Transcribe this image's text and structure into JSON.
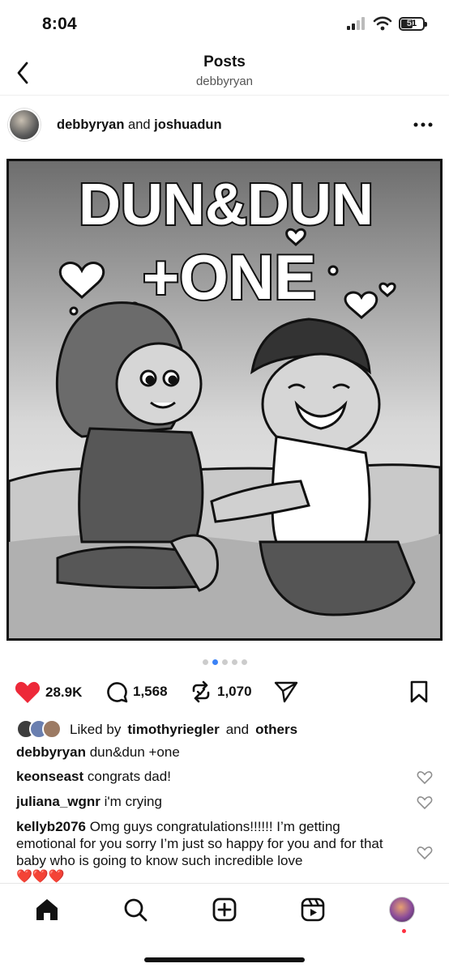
{
  "status_bar": {
    "time": "8:04",
    "battery": "51"
  },
  "header": {
    "title": "Posts",
    "subtitle": "debbyryan"
  },
  "post": {
    "author_primary": "debbyryan",
    "author_joiner": "and",
    "author_secondary": "joshuadun",
    "image_title_line1": "DUN&DUN",
    "image_title_line2": "+ONE",
    "carousel": {
      "total": 5,
      "active_index": 1
    }
  },
  "actions": {
    "likes": "28.9K",
    "comments": "1,568",
    "reposts": "1,070"
  },
  "liked_by": {
    "prefix": "Liked by",
    "user": "timothyriegler",
    "joiner": "and",
    "others": "others"
  },
  "caption": {
    "user": "debbyryan",
    "text": "dun&dun +one"
  },
  "comments": [
    {
      "user": "keonseast",
      "text": "congrats dad!"
    },
    {
      "user": "juliana_wgnr",
      "text": "i'm crying"
    },
    {
      "user": "kellyb2076",
      "text": "Omg guys congratulations!!!!!! I’m getting emotional for you sorry I’m just so happy for you and for that baby who is going to know such incredible love",
      "emoji": "❤️❤️❤️"
    }
  ],
  "colors": {
    "like_red": "#ed2939",
    "carousel_active": "#3b82f6"
  },
  "icons": {
    "tab_bar": [
      "home-icon",
      "search-icon",
      "create-icon",
      "reels-icon",
      "profile-avatar"
    ]
  }
}
